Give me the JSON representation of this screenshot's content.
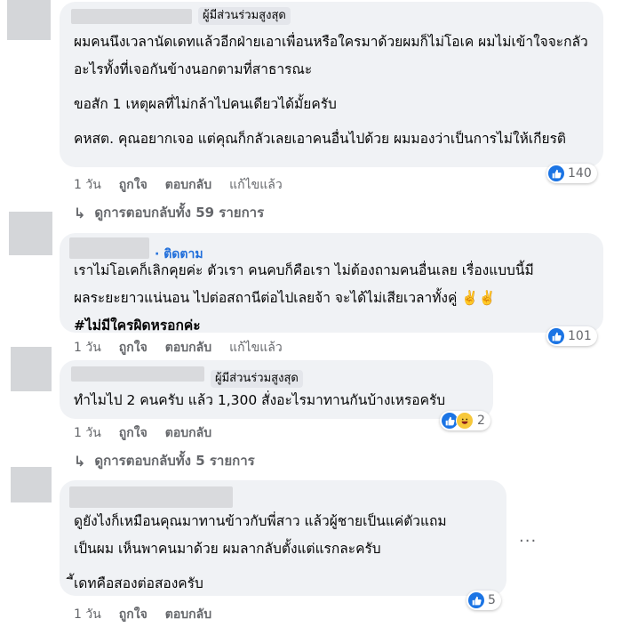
{
  "comments": [
    {
      "badge": "ผู้มีส่วนร่วมสูงสุด",
      "paragraphs": [
        "ผมคนนึงเวลานัดเดทแล้วอีกฝ่ายเอาเพื่อนหรือใครมาด้วยผมก็ไม่โอเค ผมไม่เข้าใจจะกลัวอะไรทั้งที่เจอกันข้างนอกตามที่สาธารณะ",
        "ขอสัก 1 เหตุผลที่ไม่กล้าไปคนเดียวได้มั้ยครับ",
        "คหสต. คุณอยากเจอ แต่คุณก็กลัวเลยเอาคนอื่นไปด้วย ผมมองว่าเป็นการไม่ให้เกียรติ"
      ],
      "reaction_count": "140",
      "time": "1 วัน",
      "like": "ถูกใจ",
      "reply": "ตอบกลับ",
      "edited": "แก้ไขแล้ว",
      "replies_link": "ดูการตอบกลับทั้ง 59 รายการ"
    },
    {
      "follow": "· ติดตาม",
      "line1": "เราไม่โอเคก็เลิกคุยค่ะ ตัวเรา คนคบก็คือเรา ไม่ต้องถามคนอื่นเลย เรื่องแบบนี้มี",
      "line2": "ผลระยะยาวแน่นอน ไปต่อสถานีต่อไปเลยจ้า จะได้ไม่เสียเวลาทั้งคู่ ✌️✌️",
      "hashtag": "#ไม่มีใครผิดหรอกค่ะ",
      "reaction_count": "101",
      "time": "1 วัน",
      "like": "ถูกใจ",
      "reply": "ตอบกลับ",
      "edited": "แก้ไขแล้ว"
    },
    {
      "badge": "ผู้มีส่วนร่วมสูงสุด",
      "text": "ทำไมไป 2 คนครับ แล้ว 1,300 สั่งอะไรมาทานกันบ้างเหรอครับ",
      "reaction_count": "2",
      "time": "1 วัน",
      "like": "ถูกใจ",
      "reply": "ตอบกลับ",
      "replies_link": "ดูการตอบกลับทั้ง 5 รายการ"
    },
    {
      "paragraphs": [
        "ดูยังไงก็เหมือนคุณมาทานข้าวกับพี่สาว แล้วผู้ชายเป็นแค่ตัวแถม",
        "เป็นผม เห็นพาคนมาด้วย ผมลากลับตั้งแต่แรกละครับ",
        "ี้เดทคือสองต่อสองครับ"
      ],
      "reaction_count": "5",
      "time": "1 วัน",
      "like": "ถูกใจ",
      "reply": "ตอบกลับ",
      "more": "···"
    }
  ],
  "colors": {
    "like_blue": "#1b74e4",
    "bubble": "#f0f2f5",
    "meta": "#65676b",
    "follow": "#216fdb"
  }
}
